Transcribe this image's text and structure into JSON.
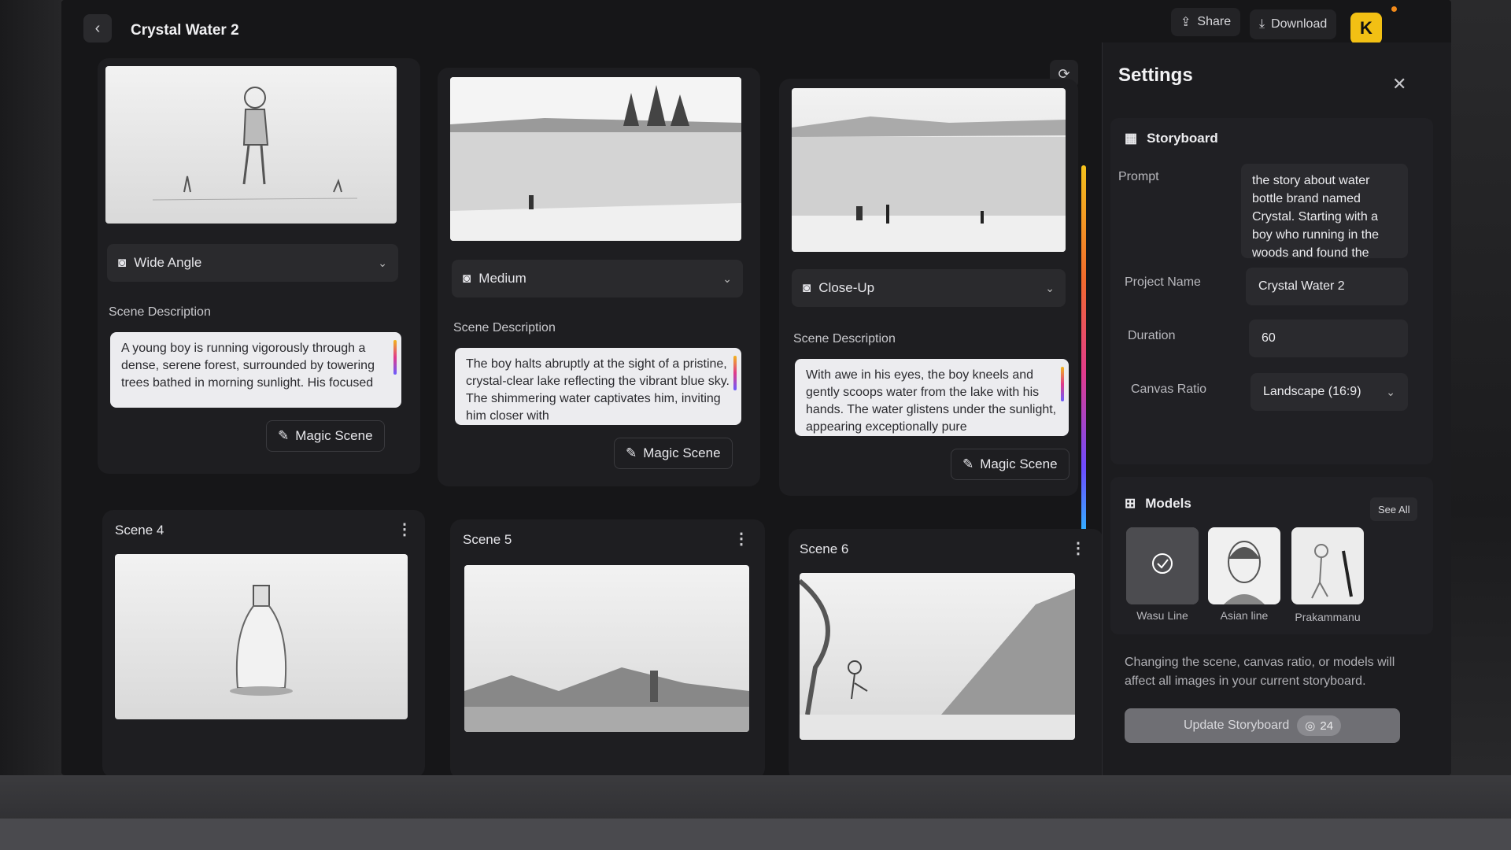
{
  "header": {
    "project_title": "Crystal Water 2",
    "share_label": "Share",
    "download_label": "Download",
    "avatar_initial": "K"
  },
  "scenes_top": [
    {
      "shot": "Wide Angle",
      "desc_label": "Scene Description",
      "description": "A young boy is running vigorously through a dense, serene forest, surrounded by towering trees bathed in morning sunlight. His focused",
      "magic_label": "Magic Scene"
    },
    {
      "shot": "Medium",
      "desc_label": "Scene Description",
      "description": "The boy halts abruptly at the sight of a pristine, crystal-clear lake reflecting the vibrant blue sky. The shimmering water captivates him, inviting him closer with",
      "magic_label": "Magic Scene"
    },
    {
      "shot": "Close-Up",
      "desc_label": "Scene Description",
      "description": "With awe in his eyes, the boy kneels and gently scoops water from the lake with his hands. The water glistens under the sunlight, appearing exceptionally pure",
      "magic_label": "Magic Scene"
    }
  ],
  "scenes_bottom": [
    {
      "title": "Scene 4"
    },
    {
      "title": "Scene 5"
    },
    {
      "title": "Scene 6"
    }
  ],
  "settings": {
    "title": "Settings",
    "storyboard_label": "Storyboard",
    "prompt_label": "Prompt",
    "prompt_value": "the story about water bottle brand named Crystal. Starting with a boy who running in the woods and found the",
    "project_name_label": "Project Name",
    "project_name_value": "Crystal Water 2",
    "duration_label": "Duration",
    "duration_value": "60",
    "canvas_ratio_label": "Canvas Ratio",
    "canvas_ratio_value": "Landscape (16:9)",
    "models_label": "Models",
    "see_all_label": "See All",
    "models": [
      {
        "name": "Wasu Line"
      },
      {
        "name": "Asian line"
      },
      {
        "name": "Prakammanu"
      }
    ],
    "notice": "Changing the scene, canvas ratio, or models will affect all images in your current storyboard.",
    "update_label": "Update Storyboard",
    "update_credits": "24"
  },
  "colors": {
    "accent_yellow": "#f2c014",
    "panel": "#1c1c1f",
    "card": "#1e1e21"
  }
}
